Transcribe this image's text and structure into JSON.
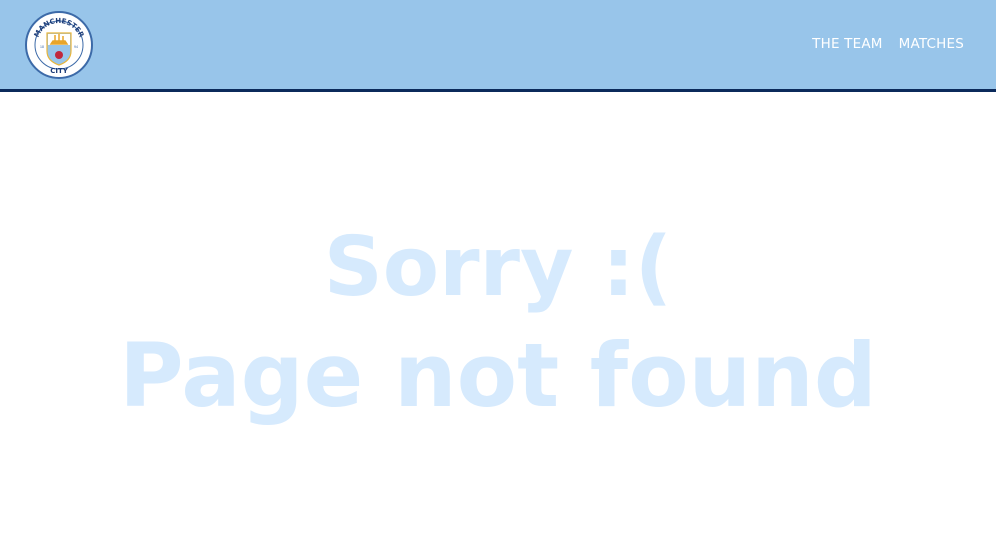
{
  "header": {
    "logo_text_top": "MANCHESTER",
    "logo_text_bottom": "CITY",
    "logo_year_left": "18",
    "logo_year_right": "94",
    "nav": [
      {
        "label": "THE TEAM"
      },
      {
        "label": "MATCHES"
      }
    ]
  },
  "main": {
    "line1": "Sorry :(",
    "line2": "Page not found"
  },
  "colors": {
    "header_bg": "#98c5ea",
    "header_border": "#0b2a5b",
    "message": "#d6eafd"
  }
}
